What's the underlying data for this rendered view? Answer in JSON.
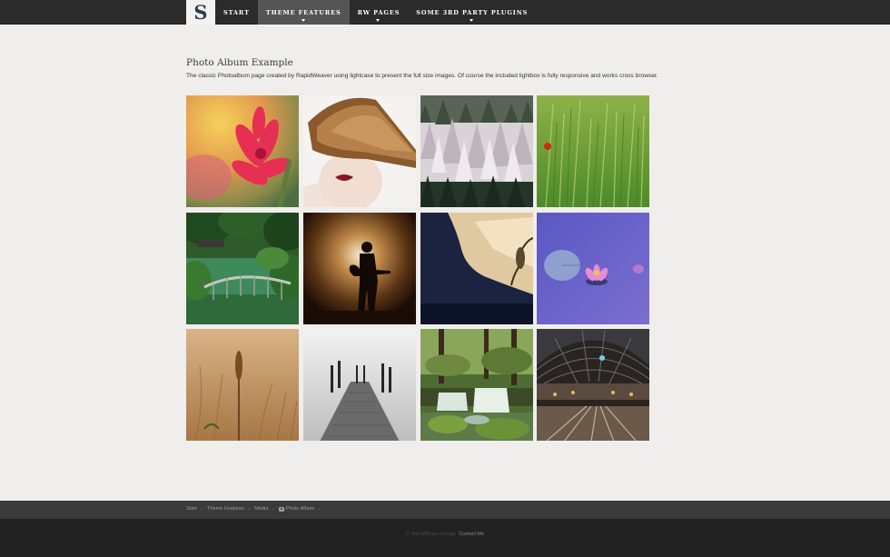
{
  "nav": {
    "logo_letter": "S",
    "items": [
      {
        "label": "START",
        "active": false,
        "has_dropdown": false
      },
      {
        "label": "THEME FEATURES",
        "active": true,
        "has_dropdown": true
      },
      {
        "label": "RW PAGES",
        "active": false,
        "has_dropdown": true
      },
      {
        "label": "SOME 3RD PARTY PLUGINS",
        "active": false,
        "has_dropdown": true
      }
    ]
  },
  "page": {
    "title": "Photo Album Example",
    "description": "The classic Photoalbum page created by RapidWeaver using lightcase to present the full size images. Of course the included lightbox is fully responsive and works cross browser."
  },
  "gallery": {
    "photos": [
      "red-flower-photo",
      "hair-portrait-photo",
      "snowy-forest-photo",
      "green-wheat-field-photo",
      "japanese-garden-bridge-photo",
      "guitarist-silhouette-photo",
      "lizard-dark-water-photo",
      "purple-lotus-photo",
      "golden-wheat-photo",
      "foggy-pier-photo",
      "forest-waterfall-photo",
      "train-station-photo"
    ]
  },
  "breadcrumb": {
    "items": [
      "Start",
      "Theme Features",
      "Media",
      "Photo Album"
    ],
    "separator": "⌄"
  },
  "footer": {
    "copyright": "© Ted Willmore Design",
    "contact_label": "Contact Me"
  },
  "colors": {
    "topbar": "#2b2b2b",
    "active_nav": "#555555",
    "background": "#f0eeed",
    "breadbar": "#3a3a3a",
    "footer": "#222222"
  }
}
